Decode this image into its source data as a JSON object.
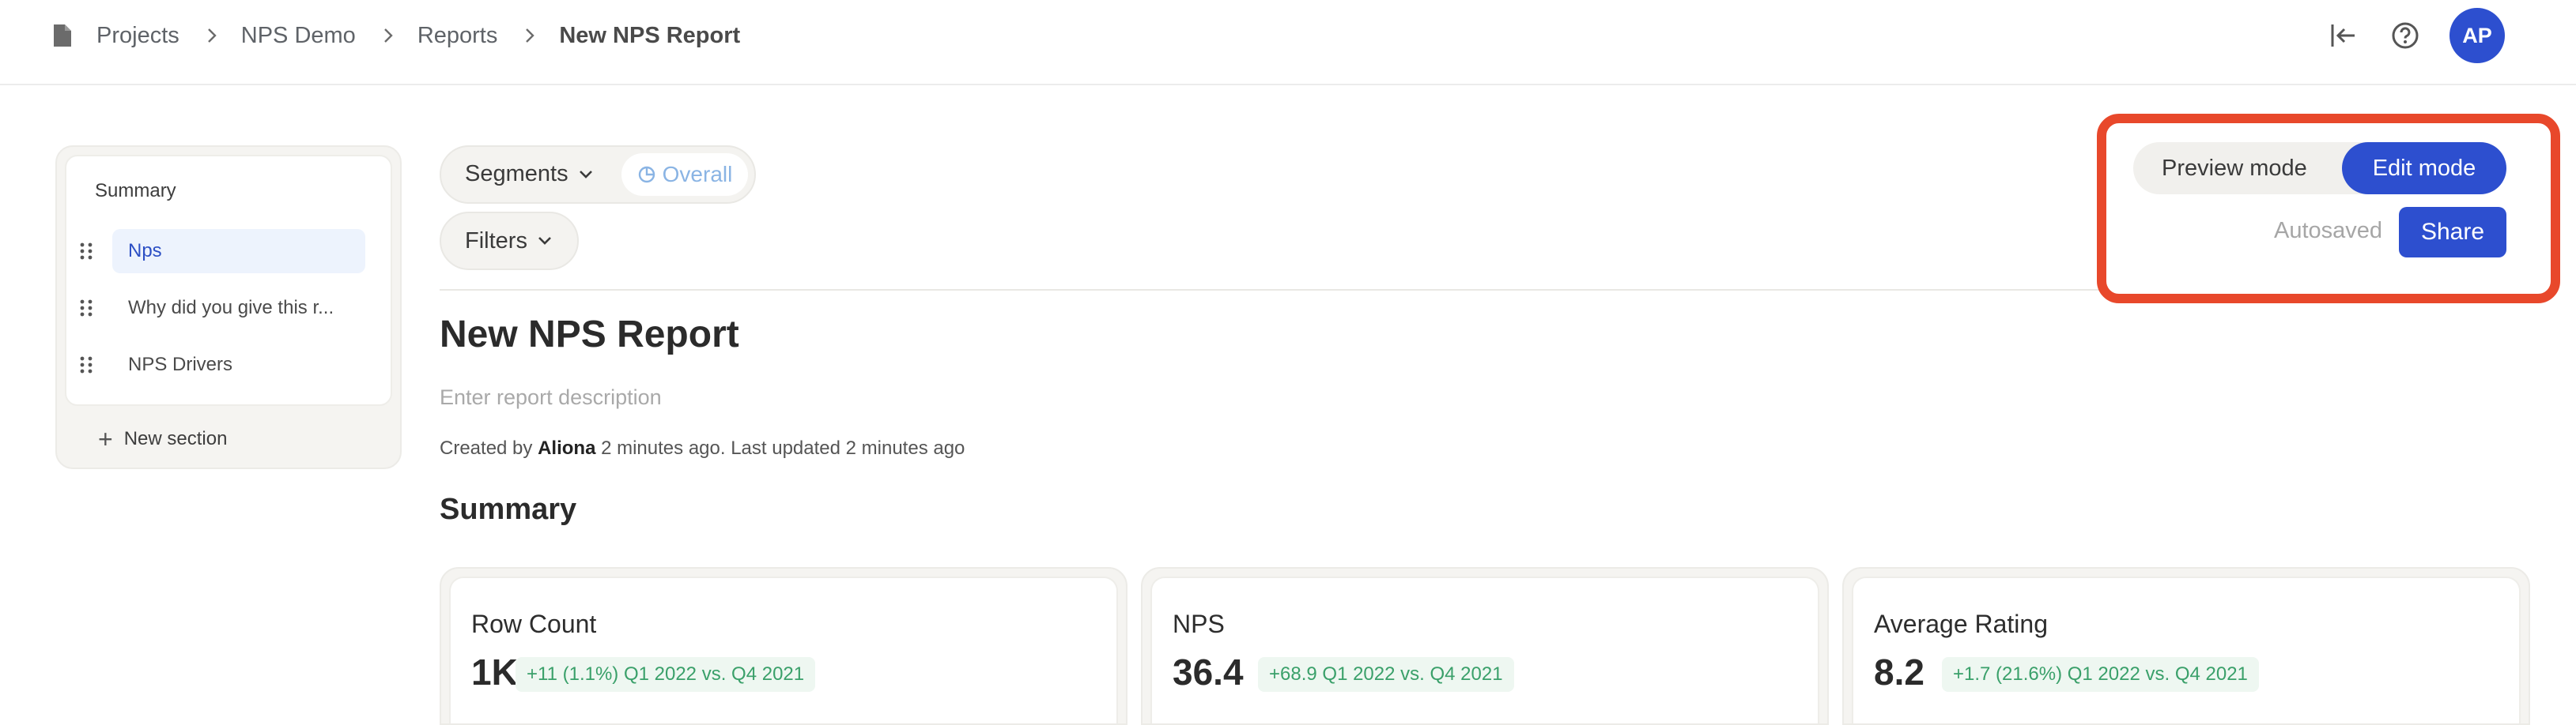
{
  "breadcrumb": {
    "items": [
      {
        "label": "Projects"
      },
      {
        "label": "NPS Demo"
      },
      {
        "label": "Reports"
      },
      {
        "label": "New NPS Report"
      }
    ]
  },
  "header": {
    "avatar_initials": "AP",
    "icons": [
      "collapse-left-icon",
      "help-icon"
    ]
  },
  "sidebar": {
    "summary_label": "Summary",
    "items": [
      {
        "label": "Nps",
        "active": true
      },
      {
        "label": "Why did you give this r..."
      },
      {
        "label": "NPS Drivers"
      }
    ],
    "new_section_label": "New section"
  },
  "toolbar": {
    "segments_label": "Segments",
    "overall_label": "Overall",
    "filters_label": "Filters"
  },
  "report": {
    "title": "New NPS Report",
    "description_placeholder": "Enter report description",
    "meta": {
      "created_by_prefix": "Created by",
      "author": "Aliona",
      "created_suffix": "2 minutes ago. Last updated 2 minutes ago"
    },
    "section_title": "Summary"
  },
  "cards": [
    {
      "label": "Row Count",
      "value": "1K",
      "delta": "+11 (1.1%) Q1 2022 vs. Q4 2021"
    },
    {
      "label": "NPS",
      "value": "36.4",
      "delta": "+68.9 Q1 2022 vs. Q4 2021"
    },
    {
      "label": "Average Rating",
      "value": "8.2",
      "delta": "+1.7 (21.6%) Q1 2022 vs. Q4 2021"
    }
  ],
  "mode": {
    "preview_label": "Preview mode",
    "edit_label": "Edit mode",
    "autosaved_label": "Autosaved",
    "share_label": "Share"
  },
  "colors": {
    "primary": "#2d4fcf",
    "highlight": "#e8482b",
    "positive": "#3aa06a"
  }
}
